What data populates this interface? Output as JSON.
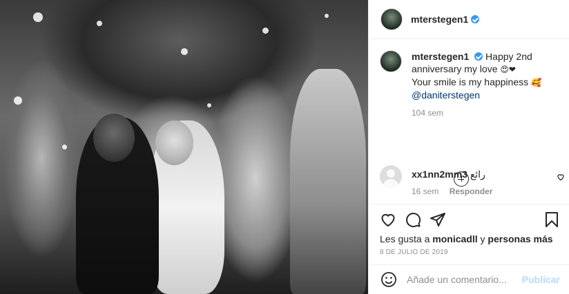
{
  "post": {
    "username": "mterstegen1",
    "caption": {
      "username": "mterstegen1",
      "text_line1": "Happy 2nd anniversary my love",
      "emoji1": "😍❤",
      "text_line2": "Your smile is my happiness",
      "emoji2": "🥰",
      "mention": "@daniterstegen",
      "time": "104 sem"
    },
    "comment": {
      "username": "xx1nn2mm3",
      "text": "رائع",
      "time": "16 sem",
      "reply_label": "Responder"
    },
    "likes": {
      "prefix": "Les gusta a",
      "user": "monicadll",
      "joiner": "y",
      "others": "personas más"
    },
    "date": "8 DE JULIO DE 2019",
    "add_comment": {
      "placeholder": "Añade un comentario...",
      "publish_label": "Publicar"
    }
  },
  "icons": [
    "verified-badge-icon",
    "load-more-icon",
    "heart-icon",
    "comment-icon",
    "share-icon",
    "bookmark-icon",
    "emoji-icon",
    "small-heart-icon"
  ],
  "colors": {
    "verified": "#3897f0",
    "mention": "#00376b",
    "publish_disabled": "#b3dbff",
    "secondary_text": "#8e8e8e"
  }
}
